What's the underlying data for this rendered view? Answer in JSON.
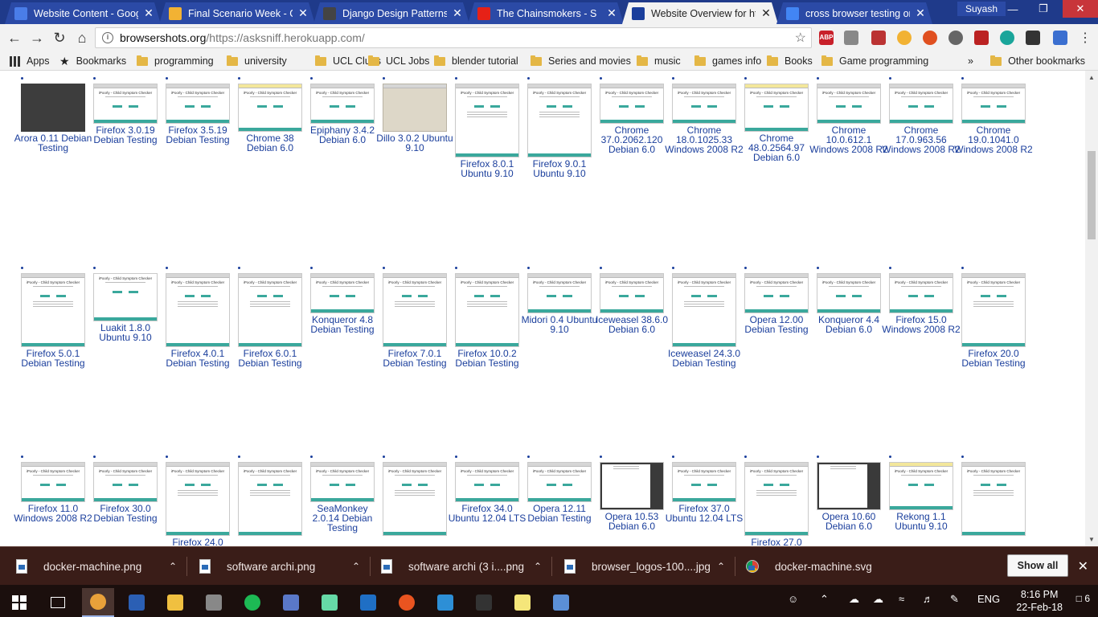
{
  "tabs": [
    {
      "title": "Website Content - Goog",
      "icon": "docs-icon",
      "color": "#4a7de8",
      "active": false
    },
    {
      "title": "Final Scenario Week - G",
      "icon": "drive-icon",
      "color": "#f2b233",
      "active": false
    },
    {
      "title": "Django Design Patterns",
      "icon": "person-icon",
      "color": "#444444",
      "active": false
    },
    {
      "title": "The Chainsmokers - S",
      "icon": "youtube-icon",
      "color": "#e62117",
      "active": false
    },
    {
      "title": "Website Overview for htt",
      "icon": "browsershots-icon",
      "color": "#1a3e9c",
      "active": true
    },
    {
      "title": "cross browser testing on",
      "icon": "google-icon",
      "color": "#4285f4",
      "active": false
    }
  ],
  "profile_name": "Suyash",
  "address": {
    "host": "browsershots.org",
    "path": "/https://asksniff.herokuapp.com/"
  },
  "extensions": {
    "abp_badge": "4",
    "on_badge": "on"
  },
  "bookmarks": [
    "Apps",
    "Bookmarks",
    "programming",
    "university",
    "UCL Clubs",
    "UCL Jobs",
    "blender tutorial",
    "Series and movies",
    "music",
    "games info",
    "Books",
    "Game programming"
  ],
  "bookmarks_overflow": "»",
  "other_bookmarks": "Other bookmarks",
  "screenshot_rows": [
    [
      {
        "label": "Arora 0.11 Debian Testing",
        "style": "dark"
      },
      {
        "label": "Firefox 3.0.19 Debian Testing",
        "style": "wide"
      },
      {
        "label": "Firefox 3.5.19 Debian Testing",
        "style": "wide"
      },
      {
        "label": "Chrome 38 Debian 6.0",
        "style": "yellowbar"
      },
      {
        "label": "Epiphany 3.4.2 Debian 6.0",
        "style": "wide"
      },
      {
        "label": "Dillo 3.0.2 Ubuntu 9.10",
        "style": "grey"
      },
      {
        "label": "Firefox 8.0.1 Ubuntu 9.10",
        "style": "tall"
      },
      {
        "label": "Firefox 9.0.1 Ubuntu 9.10",
        "style": "tall"
      },
      {
        "label": "Chrome 37.0.2062.120 Debian 6.0",
        "style": "wide"
      },
      {
        "label": "Chrome 18.0.1025.33 Windows 2008 R2",
        "style": "wide"
      },
      {
        "label": "Chrome 48.0.2564.97 Debian 6.0",
        "style": "yellowbar"
      },
      {
        "label": "Chrome 10.0.612.1 Windows 2008 R2",
        "style": "wide"
      },
      {
        "label": "Chrome 17.0.963.56 Windows 2008 R2",
        "style": "wide"
      },
      {
        "label": "Chrome 19.0.1041.0 Windows 2008 R2",
        "style": "wide"
      }
    ],
    [
      {
        "label": "Firefox 5.0.1 Debian Testing",
        "style": "tall"
      },
      {
        "label": "Luakit 1.8.0 Ubuntu 9.10",
        "style": "plain"
      },
      {
        "label": "Firefox 4.0.1 Debian Testing",
        "style": "tall"
      },
      {
        "label": "Firefox 6.0.1 Debian Testing",
        "style": "tall"
      },
      {
        "label": "Konqueror 4.8 Debian Testing",
        "style": "wide"
      },
      {
        "label": "Firefox 7.0.1 Debian Testing",
        "style": "tall"
      },
      {
        "label": "Firefox 10.0.2 Debian Testing",
        "style": "tall"
      },
      {
        "label": "Midori 0.4 Ubuntu 9.10",
        "style": "wide"
      },
      {
        "label": "Iceweasel 38.6.0 Debian 6.0",
        "style": "wide"
      },
      {
        "label": "Iceweasel 24.3.0 Debian Testing",
        "style": "tall"
      },
      {
        "label": "Opera 12.00 Debian Testing",
        "style": "wide"
      },
      {
        "label": "Konqueror 4.4 Debian 6.0",
        "style": "wide"
      },
      {
        "label": "Firefox 15.0 Windows 2008 R2",
        "style": "wide"
      },
      {
        "label": "Firefox 20.0 Debian Testing",
        "style": "tall"
      }
    ],
    [
      {
        "label": "Firefox 11.0 Windows 2008 R2",
        "style": "wide"
      },
      {
        "label": "Firefox 30.0 Debian Testing",
        "style": "wide"
      },
      {
        "label": "Firefox 24.0",
        "style": "tall"
      },
      {
        "label": "",
        "style": "tall"
      },
      {
        "label": "SeaMonkey 2.0.14 Debian Testing",
        "style": "wide"
      },
      {
        "label": "",
        "style": "tall"
      },
      {
        "label": "Firefox 34.0 Ubuntu 12.04 LTS",
        "style": "wide"
      },
      {
        "label": "Opera 12.11 Debian Testing",
        "style": "wide"
      },
      {
        "label": "Opera 10.53 Debian 6.0",
        "style": "darkframe"
      },
      {
        "label": "Firefox 37.0 Ubuntu 12.04 LTS",
        "style": "wide"
      },
      {
        "label": "Firefox 27.0",
        "style": "tall"
      },
      {
        "label": "Opera 10.60 Debian 6.0",
        "style": "darkframe"
      },
      {
        "label": "Rekong 1.1 Ubuntu 9.10",
        "style": "yellowbar"
      },
      {
        "label": "",
        "style": "tall"
      }
    ]
  ],
  "thumb_text": {
    "title": "iPoorly - Child Symptom Checker",
    "subtitle": "Information about the website",
    "login": "Login or Sign up",
    "skip": "Skip login"
  },
  "downloads": [
    {
      "name": "docker-machine.png",
      "icon": "image-file-icon"
    },
    {
      "name": "software archi.png",
      "icon": "image-file-icon"
    },
    {
      "name": "software archi (3 i....png",
      "icon": "image-file-icon"
    },
    {
      "name": "browser_logos-100....jpg",
      "icon": "image-file-icon"
    },
    {
      "name": "docker-machine.svg",
      "icon": "chrome-file-icon"
    }
  ],
  "show_all_label": "Show all",
  "taskbar": {
    "apps": [
      {
        "name": "chrome",
        "color": "#e8a13a",
        "active": true
      },
      {
        "name": "word",
        "color": "#2b5fb4",
        "active": false
      },
      {
        "name": "file-explorer",
        "color": "#f0c040",
        "active": false
      },
      {
        "name": "inkscape",
        "color": "#888888",
        "active": false
      },
      {
        "name": "spotify",
        "color": "#1db954",
        "active": false
      },
      {
        "name": "blender",
        "color": "#5a78c8",
        "active": false
      },
      {
        "name": "atom",
        "color": "#66d9a6",
        "active": false
      },
      {
        "name": "outlook",
        "color": "#1f6fc5",
        "active": false
      },
      {
        "name": "ubuntu",
        "color": "#e95420",
        "active": false
      },
      {
        "name": "vscode",
        "color": "#2d8fd6",
        "active": false
      },
      {
        "name": "terminal",
        "color": "#333333",
        "active": false
      },
      {
        "name": "sticky-notes",
        "color": "#f5e67a",
        "active": false
      },
      {
        "name": "paint",
        "color": "#5b8fd6",
        "active": false
      }
    ],
    "language": "ENG",
    "time": "8:16 PM",
    "date": "22-Feb-18",
    "notifications": "6"
  }
}
